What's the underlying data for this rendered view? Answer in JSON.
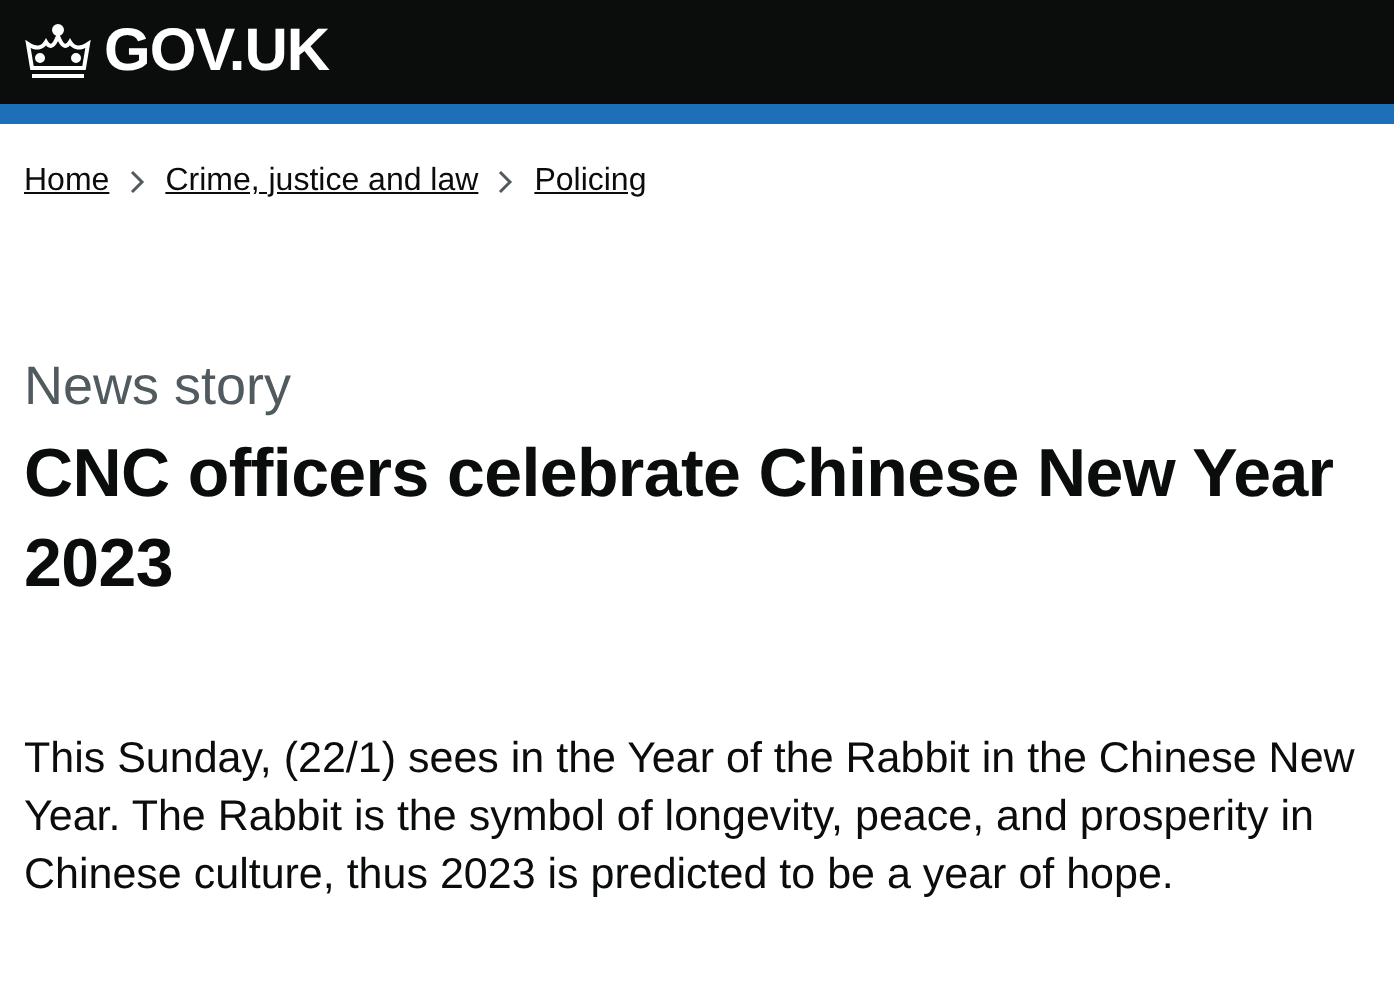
{
  "header": {
    "logo": "GOV.UK"
  },
  "breadcrumbs": [
    {
      "label": "Home"
    },
    {
      "label": "Crime, justice and law"
    },
    {
      "label": "Policing"
    }
  ],
  "caption": "News story",
  "title": "CNC officers celebrate Chinese New Year 2023",
  "lead": "This Sunday, (22/1) sees in the Year of the Rabbit in the Chinese New Year. The Rabbit is the symbol of longevity, peace, and prosperity in Chinese culture, thus 2023 is predicted to be a year of hope."
}
